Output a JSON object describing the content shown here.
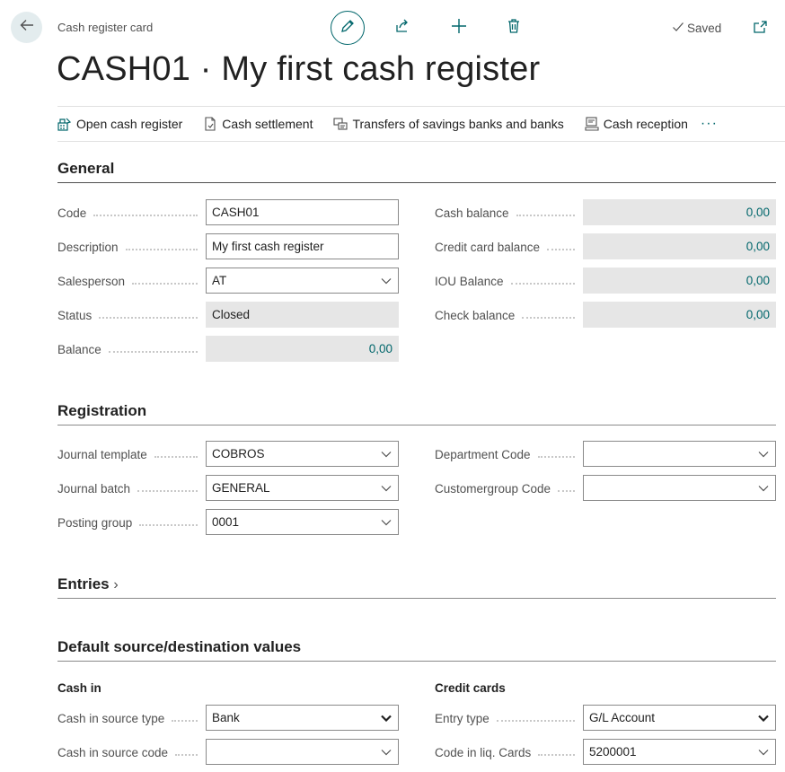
{
  "header": {
    "page_kind": "Cash register card",
    "saved_label": "Saved",
    "title": "CASH01 · My first cash register"
  },
  "actions": [
    {
      "label": "Open cash register",
      "icon": "open-register-icon"
    },
    {
      "label": "Cash settlement",
      "icon": "document-icon"
    },
    {
      "label": "Transfers of savings banks and banks",
      "icon": "transfer-icon"
    },
    {
      "label": "Cash reception",
      "icon": "reception-icon"
    }
  ],
  "more_label": "···",
  "general": {
    "title": "General",
    "code": {
      "label": "Code",
      "value": "CASH01"
    },
    "description": {
      "label": "Description",
      "value": "My first cash register"
    },
    "salesperson": {
      "label": "Salesperson",
      "value": "AT"
    },
    "status": {
      "label": "Status",
      "value": "Closed"
    },
    "balance": {
      "label": "Balance",
      "value": "0,00"
    },
    "cash_balance": {
      "label": "Cash balance",
      "value": "0,00"
    },
    "credit_card_balance": {
      "label": "Credit card balance",
      "value": "0,00"
    },
    "iou_balance": {
      "label": "IOU Balance",
      "value": "0,00"
    },
    "check_balance": {
      "label": "Check balance",
      "value": "0,00"
    }
  },
  "registration": {
    "title": "Registration",
    "journal_template": {
      "label": "Journal template",
      "value": "COBROS"
    },
    "journal_batch": {
      "label": "Journal batch",
      "value": "GENERAL"
    },
    "posting_group": {
      "label": "Posting group",
      "value": "0001"
    },
    "department_code": {
      "label": "Department Code",
      "value": ""
    },
    "customergroup_code": {
      "label": "Customergroup Code",
      "value": ""
    }
  },
  "entries": {
    "title": "Entries",
    "chevron": "›"
  },
  "defaults": {
    "title": "Default source/destination values",
    "cash_in": {
      "title": "Cash in",
      "source_type": {
        "label": "Cash in source type",
        "value": "Bank"
      },
      "source_code": {
        "label": "Cash in source code",
        "value": ""
      }
    },
    "credit_cards": {
      "title": "Credit cards",
      "entry_type": {
        "label": "Entry type",
        "value": "G/L Account"
      },
      "code_liq": {
        "label": "Code in liq. Cards",
        "value": "5200001"
      }
    }
  },
  "colors": {
    "accent": "#00666b",
    "readonly_bg": "#e6e6e6"
  }
}
